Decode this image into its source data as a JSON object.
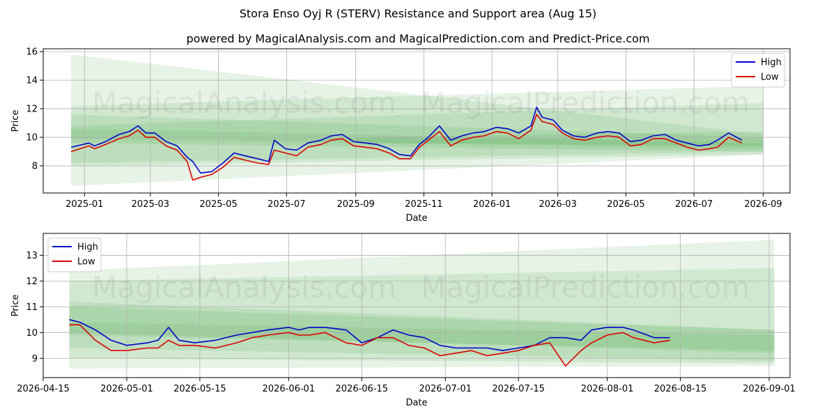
{
  "title": "Stora Enso Oyj R (STERV) Resistance and Support area (Aug 15)",
  "subtitle": "powered by MagicalAnalysis.com and MagicalPrediction.com and Predict-Price.com",
  "watermarks": [
    "MagicalAnalysis.com",
    "MagicalPrediction.com"
  ],
  "colors": {
    "high": "#0000cc",
    "low": "#dd0000",
    "band": "#2e9b2e",
    "grid": "#b0b0b0"
  },
  "chart_data": [
    {
      "type": "line",
      "xlabel": "Date",
      "ylabel": "Price",
      "legend_position": "top-right",
      "grid": true,
      "xlim": [
        "2024-11-25",
        "2026-09-25"
      ],
      "ylim": [
        6.1,
        16.2
      ],
      "x_ticks": [
        "2025-01",
        "2025-03",
        "2025-05",
        "2025-07",
        "2025-09",
        "2025-11",
        "2026-01",
        "2026-03",
        "2026-05",
        "2026-07",
        "2026-09"
      ],
      "x_tick_dates": [
        "2025-01-01",
        "2025-03-01",
        "2025-05-01",
        "2025-07-01",
        "2025-09-01",
        "2025-11-01",
        "2026-01-01",
        "2026-03-01",
        "2026-05-01",
        "2026-07-01",
        "2026-09-01"
      ],
      "y_ticks": [
        8,
        10,
        12,
        14,
        16
      ],
      "bands": [
        {
          "x": [
            "2024-12-20",
            "2026-09-01"
          ],
          "upper": [
            15.8,
            10.2
          ],
          "lower": [
            6.6,
            8.8
          ]
        },
        {
          "x": [
            "2024-12-20",
            "2026-09-01"
          ],
          "upper": [
            12.2,
            13.6
          ],
          "lower": [
            8.0,
            8.8
          ]
        },
        {
          "x": [
            "2024-12-20",
            "2026-09-01"
          ],
          "upper": [
            10.8,
            12.4
          ],
          "lower": [
            8.2,
            9.0
          ]
        },
        {
          "x": [
            "2024-12-20",
            "2026-09-01"
          ],
          "upper": [
            10.6,
            9.6
          ],
          "lower": [
            9.6,
            9.0
          ]
        },
        {
          "x": [
            "2024-12-20",
            "2026-09-01"
          ],
          "upper": [
            11.6,
            10.0
          ],
          "lower": [
            9.9,
            9.2
          ]
        },
        {
          "x": [
            "2025-09-01",
            "2026-09-01"
          ],
          "upper": [
            10.0,
            10.4
          ],
          "lower": [
            9.6,
            9.4
          ]
        }
      ],
      "series": [
        {
          "name": "High",
          "color": "#0000cc",
          "x": [
            "2024-12-20",
            "2025-01-05",
            "2025-01-10",
            "2025-01-20",
            "2025-02-01",
            "2025-02-10",
            "2025-02-18",
            "2025-02-25",
            "2025-03-05",
            "2025-03-15",
            "2025-03-25",
            "2025-04-03",
            "2025-04-08",
            "2025-04-15",
            "2025-04-25",
            "2025-05-05",
            "2025-05-15",
            "2025-05-25",
            "2025-06-05",
            "2025-06-15",
            "2025-06-20",
            "2025-06-30",
            "2025-07-10",
            "2025-07-20",
            "2025-08-01",
            "2025-08-10",
            "2025-08-20",
            "2025-08-30",
            "2025-09-10",
            "2025-09-20",
            "2025-10-01",
            "2025-10-10",
            "2025-10-20",
            "2025-10-28",
            "2025-11-05",
            "2025-11-15",
            "2025-11-25",
            "2025-12-05",
            "2025-12-15",
            "2025-12-25",
            "2026-01-05",
            "2026-01-15",
            "2026-01-25",
            "2026-02-05",
            "2026-02-10",
            "2026-02-15",
            "2026-02-25",
            "2026-03-05",
            "2026-03-15",
            "2026-03-25",
            "2026-04-05",
            "2026-04-15",
            "2026-04-25",
            "2026-05-05",
            "2026-05-15",
            "2026-05-25",
            "2026-06-05",
            "2026-06-15",
            "2026-06-25",
            "2026-07-05",
            "2026-07-15",
            "2026-07-22",
            "2026-08-01",
            "2026-08-13"
          ],
          "values": [
            9.3,
            9.6,
            9.4,
            9.7,
            10.2,
            10.4,
            10.8,
            10.3,
            10.3,
            9.7,
            9.4,
            8.6,
            8.3,
            7.5,
            7.6,
            8.2,
            8.9,
            8.7,
            8.5,
            8.3,
            9.8,
            9.2,
            9.1,
            9.6,
            9.8,
            10.1,
            10.2,
            9.7,
            9.6,
            9.5,
            9.2,
            8.8,
            8.7,
            9.5,
            10.0,
            10.8,
            9.8,
            10.1,
            10.3,
            10.4,
            10.7,
            10.6,
            10.3,
            10.8,
            12.1,
            11.4,
            11.2,
            10.5,
            10.1,
            10.0,
            10.3,
            10.4,
            10.3,
            9.7,
            9.8,
            10.1,
            10.2,
            9.8,
            9.6,
            9.4,
            9.5,
            9.8,
            10.3,
            9.8
          ]
        },
        {
          "name": "Low",
          "color": "#dd0000",
          "x": [
            "2024-12-20",
            "2025-01-05",
            "2025-01-10",
            "2025-01-20",
            "2025-02-01",
            "2025-02-10",
            "2025-02-18",
            "2025-02-25",
            "2025-03-05",
            "2025-03-15",
            "2025-03-25",
            "2025-04-03",
            "2025-04-08",
            "2025-04-15",
            "2025-04-25",
            "2025-05-05",
            "2025-05-15",
            "2025-05-25",
            "2025-06-05",
            "2025-06-15",
            "2025-06-20",
            "2025-06-30",
            "2025-07-10",
            "2025-07-20",
            "2025-08-01",
            "2025-08-10",
            "2025-08-20",
            "2025-08-30",
            "2025-09-10",
            "2025-09-20",
            "2025-10-01",
            "2025-10-10",
            "2025-10-20",
            "2025-10-28",
            "2025-11-05",
            "2025-11-15",
            "2025-11-25",
            "2025-12-05",
            "2025-12-15",
            "2025-12-25",
            "2026-01-05",
            "2026-01-15",
            "2026-01-25",
            "2026-02-05",
            "2026-02-10",
            "2026-02-15",
            "2026-02-25",
            "2026-03-05",
            "2026-03-15",
            "2026-03-25",
            "2026-04-05",
            "2026-04-15",
            "2026-04-25",
            "2026-05-05",
            "2026-05-15",
            "2026-05-25",
            "2026-06-05",
            "2026-06-15",
            "2026-06-25",
            "2026-07-05",
            "2026-07-15",
            "2026-07-22",
            "2026-08-01",
            "2026-08-13"
          ],
          "values": [
            9.0,
            9.4,
            9.2,
            9.5,
            9.9,
            10.1,
            10.5,
            10.0,
            10.0,
            9.4,
            9.1,
            8.3,
            7.0,
            7.2,
            7.4,
            7.9,
            8.6,
            8.4,
            8.2,
            8.1,
            9.1,
            8.9,
            8.7,
            9.3,
            9.5,
            9.8,
            9.9,
            9.4,
            9.3,
            9.2,
            8.9,
            8.5,
            8.5,
            9.3,
            9.8,
            10.4,
            9.4,
            9.8,
            10.0,
            10.1,
            10.4,
            10.3,
            9.9,
            10.5,
            11.6,
            11.1,
            10.9,
            10.3,
            9.9,
            9.8,
            10.0,
            10.1,
            10.0,
            9.4,
            9.5,
            9.9,
            9.9,
            9.6,
            9.3,
            9.1,
            9.2,
            9.3,
            10.0,
            9.6
          ]
        }
      ]
    },
    {
      "type": "line",
      "xlabel": "Date",
      "ylabel": "Price",
      "legend_position": "top-left",
      "grid": true,
      "xlim": [
        "2026-04-15",
        "2026-09-05"
      ],
      "ylim": [
        8.25,
        13.85
      ],
      "x_ticks": [
        "2026-04-15",
        "2026-05-01",
        "2026-05-15",
        "2026-06-01",
        "2026-06-15",
        "2026-07-01",
        "2026-07-15",
        "2026-08-01",
        "2026-08-15",
        "2026-09-01"
      ],
      "y_ticks": [
        9,
        10,
        11,
        12,
        13
      ],
      "bands": [
        {
          "x": [
            "2026-04-20",
            "2026-09-02"
          ],
          "upper": [
            12.4,
            13.6
          ],
          "lower": [
            8.6,
            8.7
          ]
        },
        {
          "x": [
            "2026-04-20",
            "2026-09-02"
          ],
          "upper": [
            12.0,
            12.5
          ],
          "lower": [
            9.0,
            8.8
          ]
        },
        {
          "x": [
            "2026-04-20",
            "2026-09-02"
          ],
          "upper": [
            11.2,
            10.1
          ],
          "lower": [
            9.4,
            8.9
          ]
        },
        {
          "x": [
            "2026-04-20",
            "2026-09-02"
          ],
          "upper": [
            11.0,
            10.1
          ],
          "lower": [
            10.0,
            9.2
          ]
        },
        {
          "x": [
            "2026-04-20",
            "2026-09-02"
          ],
          "upper": [
            10.4,
            9.9
          ],
          "lower": [
            9.9,
            9.3
          ]
        }
      ],
      "series": [
        {
          "name": "High",
          "color": "#0000cc",
          "x": [
            "2026-04-20",
            "2026-04-22",
            "2026-04-25",
            "2026-04-28",
            "2026-05-01",
            "2026-05-05",
            "2026-05-07",
            "2026-05-09",
            "2026-05-11",
            "2026-05-14",
            "2026-05-18",
            "2026-05-22",
            "2026-05-25",
            "2026-05-28",
            "2026-06-01",
            "2026-06-03",
            "2026-06-05",
            "2026-06-08",
            "2026-06-12",
            "2026-06-15",
            "2026-06-18",
            "2026-06-21",
            "2026-06-24",
            "2026-06-27",
            "2026-06-30",
            "2026-07-03",
            "2026-07-06",
            "2026-07-09",
            "2026-07-12",
            "2026-07-15",
            "2026-07-18",
            "2026-07-21",
            "2026-07-24",
            "2026-07-27",
            "2026-07-29",
            "2026-08-01",
            "2026-08-04",
            "2026-08-06",
            "2026-08-10",
            "2026-08-13"
          ],
          "values": [
            10.5,
            10.4,
            10.1,
            9.7,
            9.5,
            9.6,
            9.7,
            10.2,
            9.7,
            9.6,
            9.7,
            9.9,
            10.0,
            10.1,
            10.2,
            10.1,
            10.2,
            10.2,
            10.1,
            9.6,
            9.8,
            10.1,
            9.9,
            9.8,
            9.5,
            9.4,
            9.4,
            9.4,
            9.3,
            9.4,
            9.5,
            9.8,
            9.8,
            9.7,
            10.1,
            10.2,
            10.2,
            10.1,
            9.8,
            9.8
          ]
        },
        {
          "name": "Low",
          "color": "#dd0000",
          "x": [
            "2026-04-20",
            "2026-04-22",
            "2026-04-25",
            "2026-04-28",
            "2026-05-01",
            "2026-05-05",
            "2026-05-07",
            "2026-05-09",
            "2026-05-11",
            "2026-05-14",
            "2026-05-18",
            "2026-05-22",
            "2026-05-25",
            "2026-05-28",
            "2026-06-01",
            "2026-06-03",
            "2026-06-05",
            "2026-06-08",
            "2026-06-12",
            "2026-06-15",
            "2026-06-18",
            "2026-06-21",
            "2026-06-24",
            "2026-06-27",
            "2026-06-30",
            "2026-07-03",
            "2026-07-06",
            "2026-07-09",
            "2026-07-12",
            "2026-07-15",
            "2026-07-18",
            "2026-07-21",
            "2026-07-24",
            "2026-07-27",
            "2026-07-29",
            "2026-08-01",
            "2026-08-04",
            "2026-08-06",
            "2026-08-10",
            "2026-08-13"
          ],
          "values": [
            10.3,
            10.3,
            9.7,
            9.3,
            9.3,
            9.4,
            9.4,
            9.7,
            9.5,
            9.5,
            9.4,
            9.6,
            9.8,
            9.9,
            10.0,
            9.9,
            9.9,
            10.0,
            9.6,
            9.5,
            9.8,
            9.8,
            9.5,
            9.4,
            9.1,
            9.2,
            9.3,
            9.1,
            9.2,
            9.3,
            9.5,
            9.6,
            8.7,
            9.3,
            9.6,
            9.9,
            10.0,
            9.8,
            9.6,
            9.7
          ]
        }
      ]
    }
  ]
}
